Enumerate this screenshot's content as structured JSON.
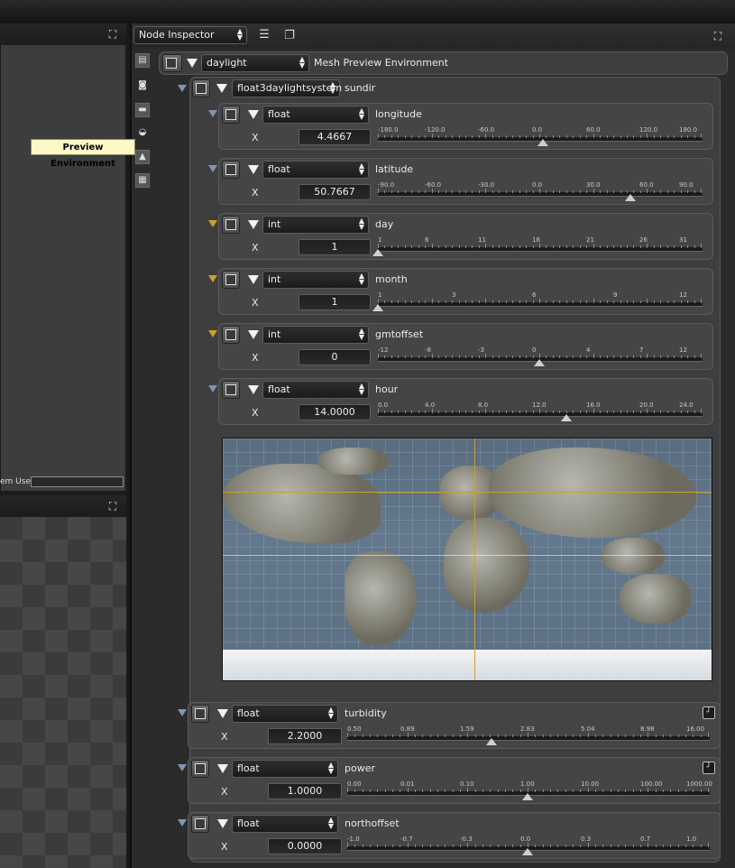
{
  "left_panel": {
    "memory_label": "em Used",
    "tooltip": "Preview Environment"
  },
  "inspector": {
    "title_combo": "Node Inspector",
    "root": {
      "combo": "daylight",
      "label": "Mesh Preview Environment"
    },
    "system": {
      "combo": "float3daylightsystem",
      "label": "sundir"
    },
    "params": [
      {
        "type": "float",
        "label": "longitude",
        "axis": "X",
        "value": "4.4667",
        "ticks": [
          "-180.0",
          "-120.0",
          "-60.0",
          "0.0",
          "60.0",
          "120.0",
          "180.0"
        ],
        "thumb_pos": 0.512,
        "connector": "blue",
        "icon": "curve"
      },
      {
        "type": "float",
        "label": "latitude",
        "axis": "X",
        "value": "50.7667",
        "ticks": [
          "-90.0",
          "-60.0",
          "-30.0",
          "0.0",
          "30.0",
          "60.0",
          "90.0"
        ],
        "thumb_pos": 0.782,
        "connector": "blue",
        "icon": "curve"
      },
      {
        "type": "int",
        "label": "day",
        "axis": "X",
        "value": "1",
        "ticks": [
          "1",
          "6",
          "11",
          "16",
          "21",
          "26",
          "31"
        ],
        "thumb_pos": 0.0,
        "connector": "gold",
        "icon": "int"
      },
      {
        "type": "int",
        "label": "month",
        "axis": "X",
        "value": "1",
        "ticks": [
          "1",
          "3",
          "6",
          "9",
          "12"
        ],
        "thumb_pos": 0.0,
        "connector": "gold",
        "icon": "int"
      },
      {
        "type": "int",
        "label": "gmtoffset",
        "axis": "X",
        "value": "0",
        "ticks": [
          "-12",
          "-8",
          "-3",
          "0",
          "4",
          "7",
          "12"
        ],
        "thumb_pos": 0.5,
        "connector": "gold",
        "icon": "int"
      },
      {
        "type": "float",
        "label": "hour",
        "axis": "X",
        "value": "14.0000",
        "ticks": [
          "0.0",
          "4.0",
          "8.0",
          "12.0",
          "16.0",
          "20.0",
          "24.0"
        ],
        "thumb_pos": 0.583,
        "connector": "blue",
        "icon": "curve"
      }
    ],
    "lower_params": [
      {
        "type": "float",
        "label": "turbidity",
        "axis": "X",
        "value": "2.2000",
        "ticks": [
          "0.50",
          "0.89",
          "1.59",
          "2.83",
          "5.04",
          "8.98",
          "16.00"
        ],
        "thumb_pos": 0.4,
        "curve_toggle": true
      },
      {
        "type": "float",
        "label": "power",
        "axis": "X",
        "value": "1.0000",
        "ticks": [
          "0.00",
          "0.01",
          "0.10",
          "1.00",
          "10.00",
          "100.00",
          "1000.00"
        ],
        "thumb_pos": 0.5,
        "curve_toggle": true
      },
      {
        "type": "float",
        "label": "northoffset",
        "axis": "X",
        "value": "0.0000",
        "ticks": [
          "-1.0",
          "-0.7",
          "-0.3",
          "0.0",
          "0.3",
          "0.7",
          "1.0"
        ],
        "thumb_pos": 0.5,
        "curve_toggle": false
      }
    ],
    "sun_marker": {
      "longitude": 4.4667,
      "latitude": 50.7667
    }
  },
  "colors": {
    "accent": "#c9a12e",
    "connector_blue": "#7f95b0"
  }
}
